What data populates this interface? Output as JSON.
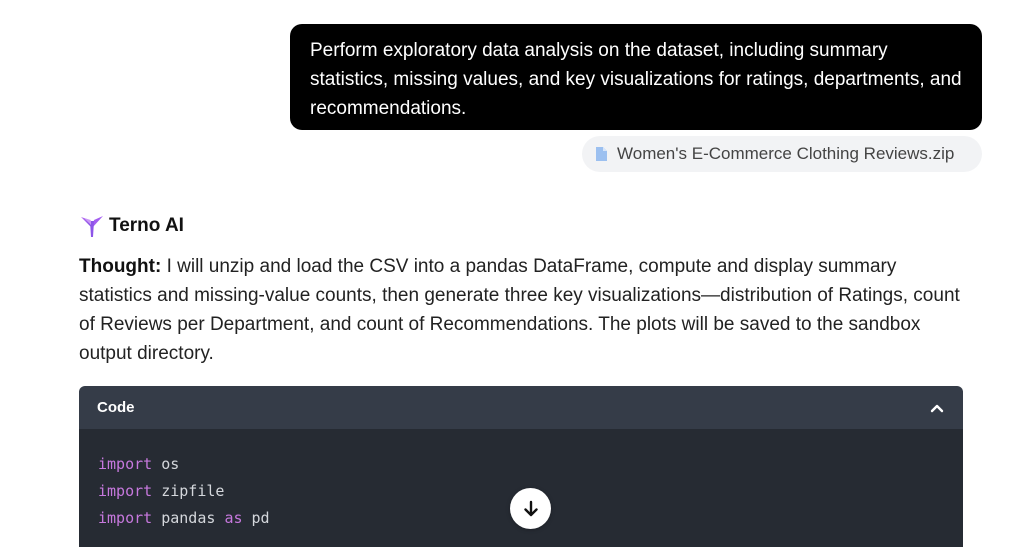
{
  "user_message": {
    "text": "Perform exploratory data analysis on the dataset, including summary statistics, missing values, and key visualizations for ratings, departments, and recommendations."
  },
  "attachment": {
    "icon": "file-icon",
    "filename": "Women's E-Commerce Clothing Reviews.zip"
  },
  "assistant": {
    "icon": "terno-logo-icon",
    "name": "Terno AI",
    "thought_label": "Thought:",
    "thought_text": " I will unzip and load the CSV into a pandas DataFrame, compute and display summary statistics and missing-value counts, then generate three key visualizations—distribution of Ratings, count of Reviews per Department, and count of Recommendations. The plots will be saved to the sandbox output directory."
  },
  "code_block": {
    "title": "Code",
    "toggle_icon": "chevron-up-icon",
    "lines": [
      {
        "kw": "import",
        "rest": " os"
      },
      {
        "kw": "import",
        "rest": " zipfile"
      },
      {
        "kw": "import",
        "rest": " pandas ",
        "kw2": "as",
        "rest2": " pd"
      }
    ]
  },
  "scroll_button": {
    "icon": "arrow-down-icon"
  },
  "colors": {
    "user_bubble_bg": "#000000",
    "attachment_bg": "#f2f3f5",
    "code_header_bg": "#353c48",
    "code_body_bg": "#262b33",
    "keyword": "#c678dd"
  }
}
